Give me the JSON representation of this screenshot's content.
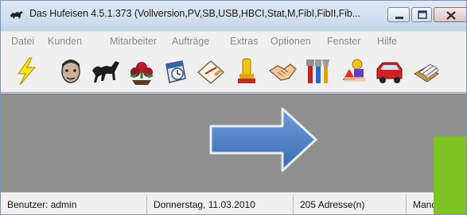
{
  "window": {
    "title": "Das Hufeisen 4.5.1.373 (Vollversion,PV,SB,USB,HBCI,Stat,M,FibI,FibII,Fib...",
    "controls": {
      "minimize": "minimize",
      "maximize": "maximize",
      "close": "close"
    }
  },
  "menu": {
    "items": [
      "Datei",
      "Kunden",
      "Mitarbeiter",
      "Aufträge",
      "Extras",
      "Optionen",
      "Fenster",
      "Hilfe"
    ]
  },
  "toolbar": {
    "icons": [
      "lightning-icon",
      "person-face-icon",
      "horse-icon",
      "flowers-icon",
      "calendar-icon",
      "note-paper-icon",
      "stamp-icon",
      "handshake-icon",
      "tools-icon",
      "shapes-icon",
      "car-icon",
      "card-box-icon"
    ]
  },
  "status": {
    "user": "Benutzer: admin",
    "date": "Donnerstag, 11.03.2010",
    "addresses": "205 Adresse(n)",
    "mandant_partial": "Mand"
  },
  "colors": {
    "workspace": "#8f8f8f",
    "arrow": "#4a7cc0",
    "green_overlay": "#7ec224",
    "menu_text_disabled": "#8a8a8a"
  }
}
